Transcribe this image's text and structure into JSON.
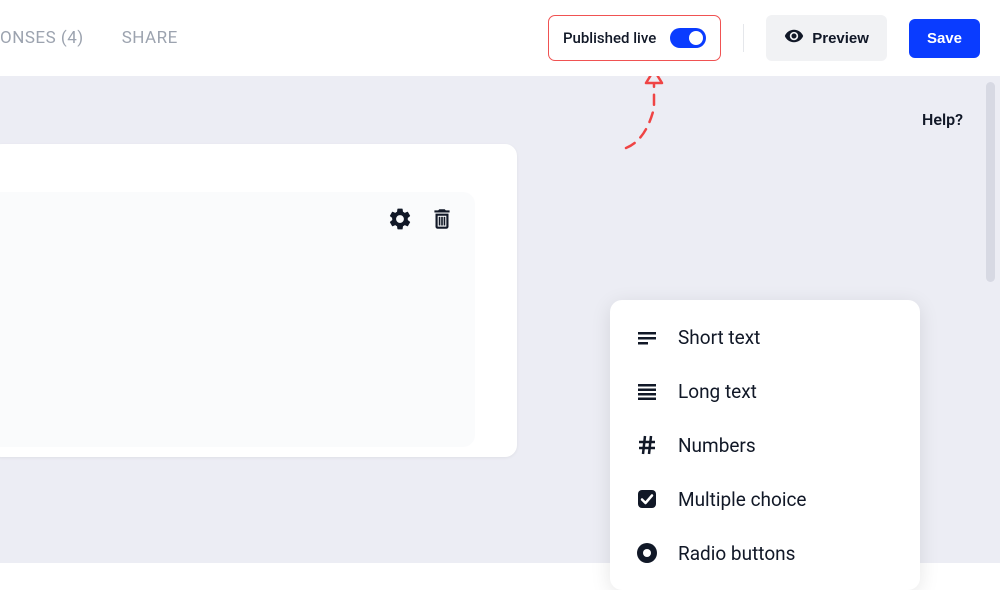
{
  "tabs": {
    "responses_fragment": "ONSES (4)",
    "share": "SHARE"
  },
  "publish": {
    "label": "Published live",
    "on": true
  },
  "buttons": {
    "preview": "Preview",
    "save": "Save"
  },
  "help": "Help?",
  "question_types": [
    {
      "icon": "short-text",
      "label": "Short text"
    },
    {
      "icon": "long-text",
      "label": "Long text"
    },
    {
      "icon": "hash",
      "label": "Numbers"
    },
    {
      "icon": "checkbox",
      "label": "Multiple choice"
    },
    {
      "icon": "radio",
      "label": "Radio buttons"
    }
  ]
}
